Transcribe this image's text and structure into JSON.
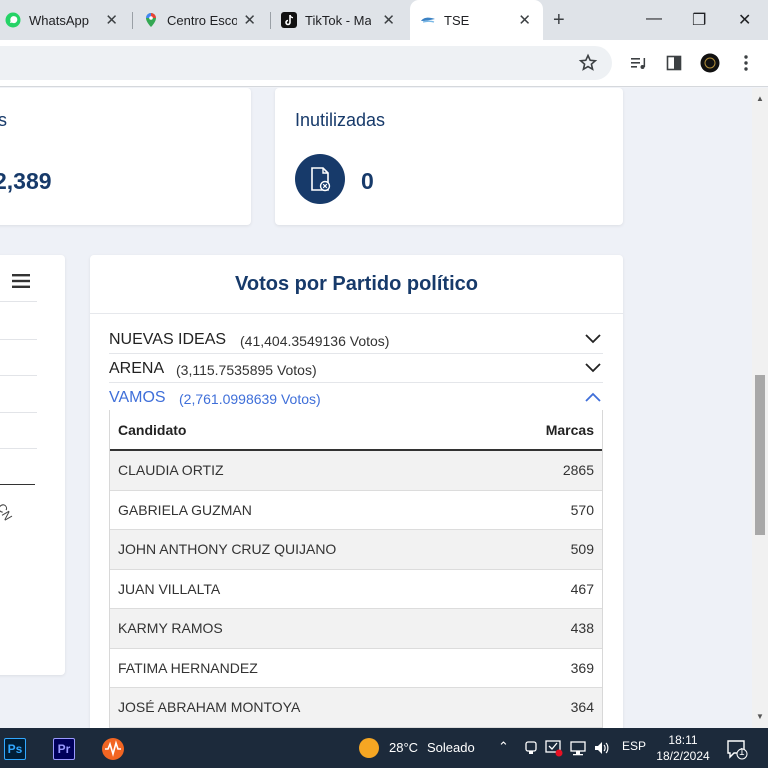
{
  "browser": {
    "tabs": [
      {
        "title": "WhatsApp",
        "icon": "whatsapp-icon"
      },
      {
        "title": "Centro Escol",
        "icon": "maps-pin-icon"
      },
      {
        "title": "TikTok - Mak",
        "icon": "tiktok-icon"
      },
      {
        "title": "TSE",
        "icon": "tse-icon",
        "active": true
      }
    ],
    "close_glyph": "✕",
    "new_tab_glyph": "+",
    "window_controls": {
      "minimize": "—",
      "restore": "❐",
      "close": "✕"
    }
  },
  "stats": {
    "left_partial_title": "s",
    "left_partial_value": "2,389",
    "inutilizadas": {
      "title": "Inutilizadas",
      "value": "0"
    }
  },
  "votes": {
    "title": "Votos por Partido político",
    "parties": [
      {
        "name": "NUEVAS IDEAS",
        "votes": "(41,404.3549136 Votos)",
        "open": false
      },
      {
        "name": "ARENA",
        "votes": "(3,115.7535895 Votos)",
        "open": false
      },
      {
        "name": "VAMOS",
        "votes": "(2,761.0998639 Votos)",
        "open": true
      }
    ],
    "table": {
      "headers": {
        "candidate": "Candidato",
        "marks": "Marcas"
      },
      "rows": [
        {
          "name": "CLAUDIA ORTIZ",
          "marks": "2865"
        },
        {
          "name": "GABRIELA GUZMAN",
          "marks": "570"
        },
        {
          "name": "JOHN ANTHONY CRUZ QUIJANO",
          "marks": "509"
        },
        {
          "name": "JUAN VILLALTA",
          "marks": "467"
        },
        {
          "name": "KARMY RAMOS",
          "marks": "438"
        },
        {
          "name": "FATIMA HERNANDEZ",
          "marks": "369"
        },
        {
          "name": "JOSÉ ABRAHAM MONTOYA",
          "marks": "364"
        }
      ]
    }
  },
  "left_chart": {
    "partial_label": "CN"
  },
  "taskbar": {
    "apps": [
      {
        "label": "Ps",
        "icon": "photoshop-icon"
      },
      {
        "label": "Pr",
        "icon": "premiere-icon"
      },
      {
        "label": "",
        "icon": "audio-app-icon"
      }
    ],
    "weather": {
      "temp": "28°C",
      "condition": "Soleado"
    },
    "language": "ESP",
    "time": "18:11",
    "date": "18/2/2024",
    "notifications": "1"
  },
  "colors": {
    "brand_navy": "#173a6a",
    "accent_blue": "#3f6fd9"
  }
}
